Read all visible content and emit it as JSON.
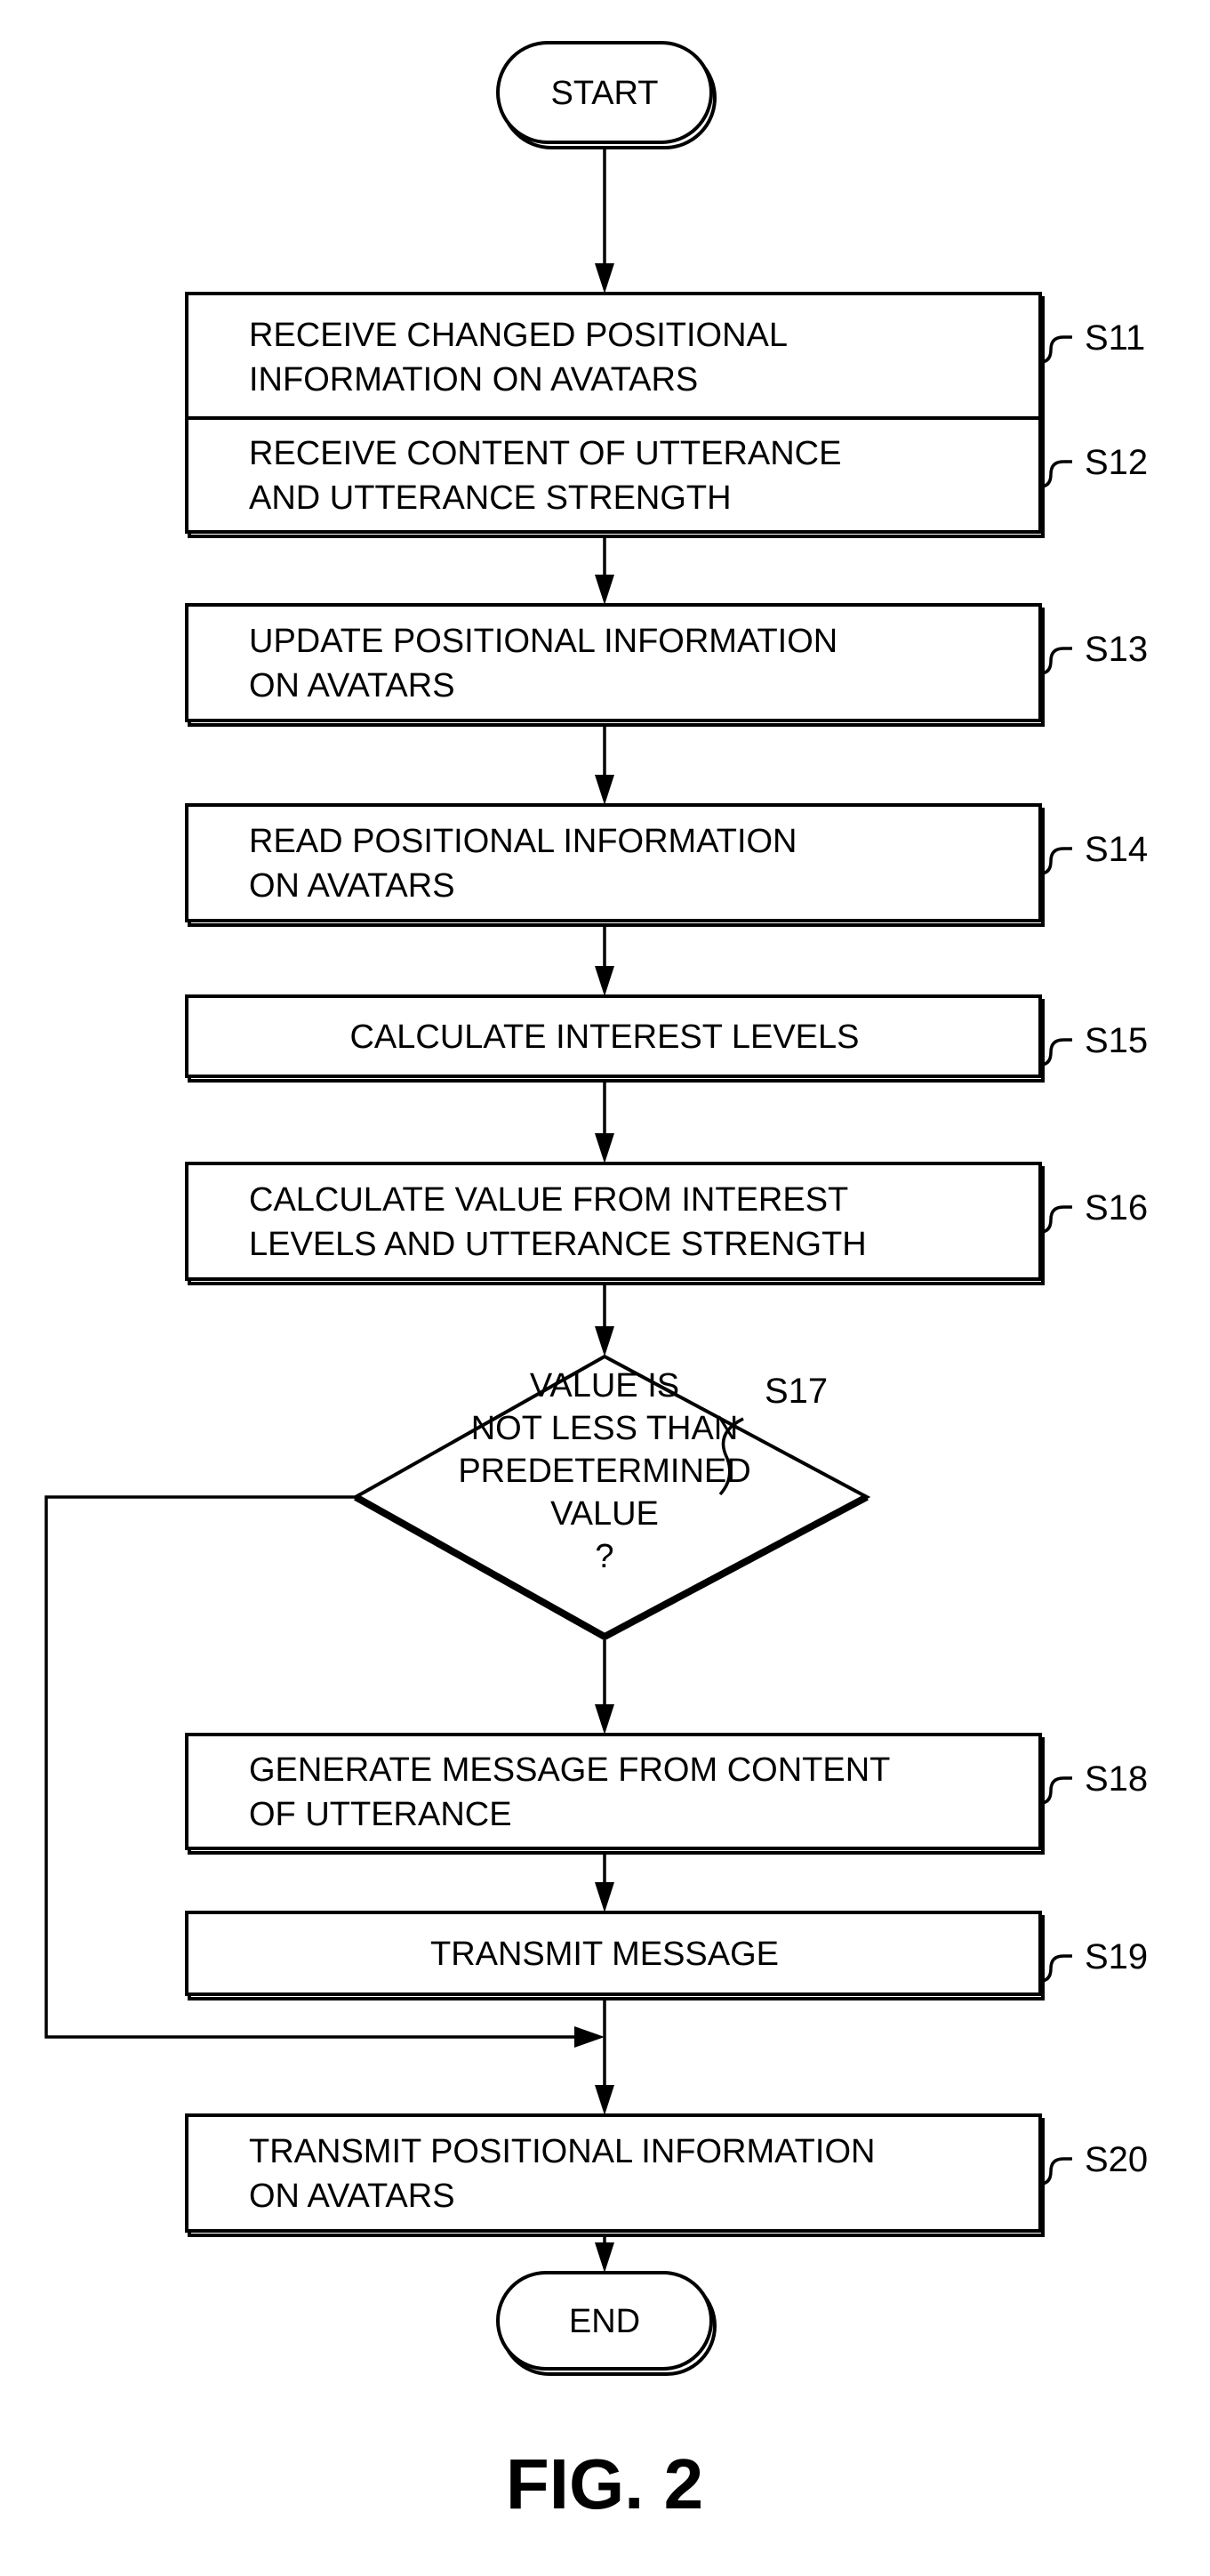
{
  "diagram": {
    "type": "flowchart",
    "figure_label": "FIG. 2",
    "start": {
      "label": "START"
    },
    "end": {
      "label": "END"
    },
    "steps": [
      {
        "id": "S11",
        "lines": [
          "RECEIVE CHANGED POSITIONAL",
          "INFORMATION ON AVATARS"
        ]
      },
      {
        "id": "S12",
        "lines": [
          "RECEIVE CONTENT OF UTTERANCE",
          "AND UTTERANCE STRENGTH"
        ]
      },
      {
        "id": "S13",
        "lines": [
          "UPDATE POSITIONAL INFORMATION",
          "ON AVATARS"
        ]
      },
      {
        "id": "S14",
        "lines": [
          "READ POSITIONAL INFORMATION",
          "ON AVATARS"
        ]
      },
      {
        "id": "S15",
        "lines": [
          "CALCULATE INTEREST LEVELS"
        ]
      },
      {
        "id": "S16",
        "lines": [
          "CALCULATE VALUE FROM INTEREST",
          "LEVELS AND UTTERANCE STRENGTH"
        ]
      },
      {
        "id": "S18",
        "lines": [
          "GENERATE MESSAGE FROM CONTENT",
          "OF UTTERANCE"
        ]
      },
      {
        "id": "S19",
        "lines": [
          "TRANSMIT MESSAGE"
        ]
      },
      {
        "id": "S20",
        "lines": [
          "TRANSMIT POSITIONAL INFORMATION",
          "ON AVATARS"
        ]
      }
    ],
    "decision": {
      "id": "S17",
      "lines": [
        "VALUE IS",
        "NOT LESS THAN",
        "PREDETERMINED",
        "VALUE",
        "?"
      ],
      "yes_target": "S18",
      "no_target": "S20"
    },
    "edges": [
      {
        "from": "START",
        "to": "S11"
      },
      {
        "from": "S11",
        "to": "S12"
      },
      {
        "from": "S12",
        "to": "S13"
      },
      {
        "from": "S13",
        "to": "S14"
      },
      {
        "from": "S14",
        "to": "S15"
      },
      {
        "from": "S15",
        "to": "S16"
      },
      {
        "from": "S16",
        "to": "S17"
      },
      {
        "from": "S17",
        "to": "S18"
      },
      {
        "from": "S18",
        "to": "S19"
      },
      {
        "from": "S19",
        "to": "S20"
      },
      {
        "from": "S17",
        "to": "S20"
      },
      {
        "from": "S20",
        "to": "END"
      }
    ]
  }
}
